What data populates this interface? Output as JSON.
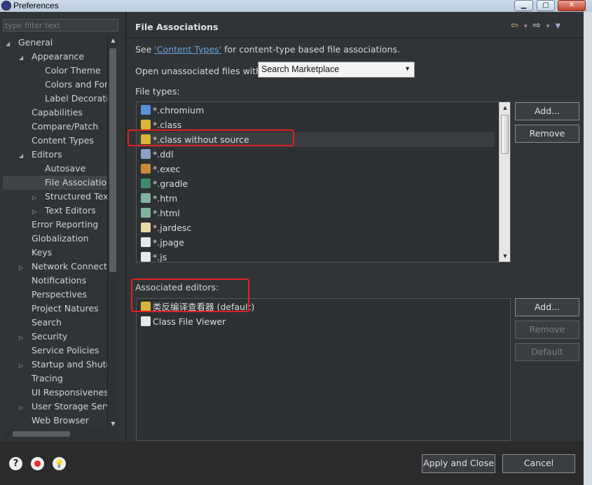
{
  "window": {
    "title": "Preferences",
    "min_glyph": "▁",
    "max_glyph": "▢",
    "close_glyph": "✕"
  },
  "filter": {
    "placeholder": "type filter text"
  },
  "tree": [
    {
      "label": "General",
      "arrow": "◢",
      "indent": 0
    },
    {
      "label": "Appearance",
      "arrow": "◢",
      "indent": 1
    },
    {
      "label": "Color Theme",
      "arrow": "",
      "indent": 2
    },
    {
      "label": "Colors and Fonts",
      "arrow": "",
      "indent": 2
    },
    {
      "label": "Label Decorations",
      "arrow": "",
      "indent": 2
    },
    {
      "label": "Capabilities",
      "arrow": "",
      "indent": 1
    },
    {
      "label": "Compare/Patch",
      "arrow": "",
      "indent": 1
    },
    {
      "label": "Content Types",
      "arrow": "",
      "indent": 1
    },
    {
      "label": "Editors",
      "arrow": "◢",
      "indent": 1
    },
    {
      "label": "Autosave",
      "arrow": "",
      "indent": 2
    },
    {
      "label": "File Associations",
      "arrow": "",
      "indent": 2,
      "selected": true
    },
    {
      "label": "Structured Text",
      "arrow": "▷",
      "indent": 2
    },
    {
      "label": "Text Editors",
      "arrow": "▷",
      "indent": 2
    },
    {
      "label": "Error Reporting",
      "arrow": "",
      "indent": 1
    },
    {
      "label": "Globalization",
      "arrow": "",
      "indent": 1
    },
    {
      "label": "Keys",
      "arrow": "",
      "indent": 1
    },
    {
      "label": "Network Connections",
      "arrow": "▷",
      "indent": 1
    },
    {
      "label": "Notifications",
      "arrow": "",
      "indent": 1
    },
    {
      "label": "Perspectives",
      "arrow": "",
      "indent": 1
    },
    {
      "label": "Project Natures",
      "arrow": "",
      "indent": 1
    },
    {
      "label": "Search",
      "arrow": "",
      "indent": 1
    },
    {
      "label": "Security",
      "arrow": "▷",
      "indent": 1
    },
    {
      "label": "Service Policies",
      "arrow": "",
      "indent": 1
    },
    {
      "label": "Startup and Shutdown",
      "arrow": "▷",
      "indent": 1
    },
    {
      "label": "Tracing",
      "arrow": "",
      "indent": 1
    },
    {
      "label": "UI Responsiveness",
      "arrow": "",
      "indent": 1
    },
    {
      "label": "User Storage Service",
      "arrow": "▷",
      "indent": 1
    },
    {
      "label": "Web Browser",
      "arrow": "",
      "indent": 1
    }
  ],
  "page": {
    "title": "File Associations",
    "nav": {
      "back": "⇦",
      "down1": "▾",
      "forward": "⇨",
      "down2": "▾",
      "menu": "▼"
    },
    "desc_pre": "See ",
    "desc_link": "'Content Types'",
    "desc_post": " for content-type based file associations.",
    "open_label": "Open unassociated files with:",
    "open_value": "Search Marketplace",
    "file_types_label": "File types:",
    "file_types": [
      {
        "label": "*.chromium",
        "color": "#5b8fd6"
      },
      {
        "label": "*.class",
        "color": "#d9b43a"
      },
      {
        "label": "*.class without source",
        "color": "#d9b43a",
        "selected": true
      },
      {
        "label": "*.ddl",
        "color": "#8aa0c8"
      },
      {
        "label": "*.exec",
        "color": "#c88a3a"
      },
      {
        "label": "*.gradle",
        "color": "#3c8a6a"
      },
      {
        "label": "*.htm",
        "color": "#7fb3a0"
      },
      {
        "label": "*.html",
        "color": "#7fb3a0"
      },
      {
        "label": "*.jardesc",
        "color": "#e8d9a8"
      },
      {
        "label": "*.jpage",
        "color": "#e8e8e8"
      },
      {
        "label": "*.js",
        "color": "#e8e8e8"
      }
    ],
    "associated_label": "Associated editors:",
    "associated": [
      {
        "label": "类反编译查看器 (default)",
        "color": "#d9b43a"
      },
      {
        "label": "Class File Viewer",
        "color": "#e8e8e8"
      }
    ],
    "buttons": {
      "add_type": "Add...",
      "remove_type": "Remove",
      "add_editor": "Add...",
      "remove_editor": "Remove",
      "default_editor": "Default"
    }
  },
  "footer": {
    "help_glyph": "?",
    "apply_close": "Apply and Close",
    "cancel": "Cancel"
  }
}
